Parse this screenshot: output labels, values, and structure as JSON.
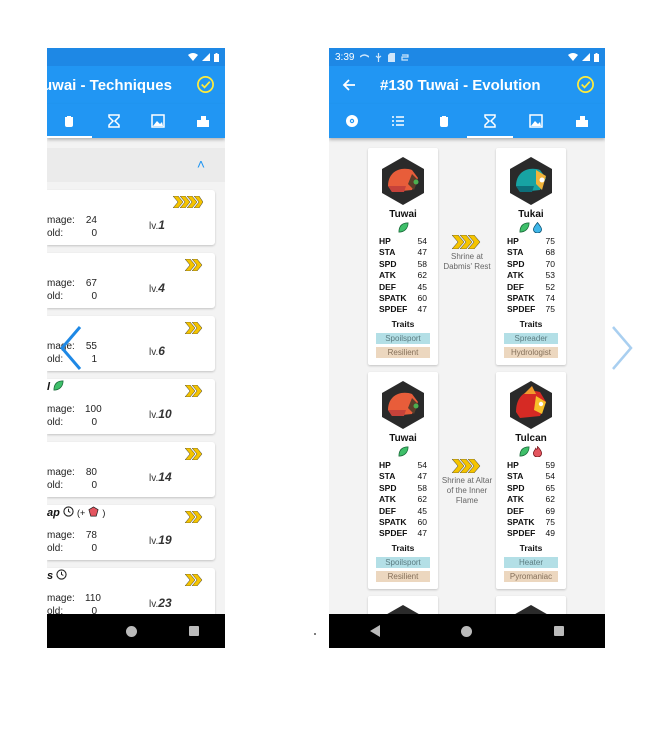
{
  "left_screen": {
    "title": "uwai - Techniques",
    "tabs": [
      "technique-tab",
      "evolution-tab",
      "gallery-tab",
      "habitat-tab"
    ],
    "techniques": [
      {
        "name": "",
        "damage_label": "mage:",
        "damage": "24",
        "hold_label": "old:",
        "hold": "0",
        "lv_prefix": "lv.",
        "level": "1",
        "chevrons": 4
      },
      {
        "name": "",
        "damage_label": "mage:",
        "damage": "67",
        "hold_label": "old:",
        "hold": "0",
        "lv_prefix": "lv.",
        "level": "4",
        "chevrons": 2
      },
      {
        "name": "",
        "damage_label": "mage:",
        "damage": "55",
        "hold_label": "old:",
        "hold": "1",
        "lv_prefix": "lv.",
        "level": "6",
        "chevrons": 2
      },
      {
        "name": "l",
        "damage_label": "mage:",
        "damage": "100",
        "hold_label": "old:",
        "hold": "0",
        "lv_prefix": "lv.",
        "level": "10",
        "chevrons": 2
      },
      {
        "name": "",
        "damage_label": "mage:",
        "damage": "80",
        "hold_label": "old:",
        "hold": "0",
        "lv_prefix": "lv.",
        "level": "14",
        "chevrons": 2
      },
      {
        "name": "ap",
        "extra": "(+",
        "extra_end": ")",
        "damage_label": "mage:",
        "damage": "78",
        "hold_label": "old:",
        "hold": "0",
        "lv_prefix": "lv.",
        "level": "19",
        "chevrons": 2
      },
      {
        "name": "s",
        "damage_label": "mage:",
        "damage": "110",
        "hold_label": "old:",
        "hold": "0",
        "lv_prefix": "lv.",
        "level": "23",
        "chevrons": 2
      }
    ]
  },
  "right_screen": {
    "time": "3:39",
    "title": "#130 Tuwai - Evolution",
    "tabs": [
      "info-tab",
      "list-tab",
      "technique-tab",
      "evolution-tab",
      "gallery-tab",
      "habitat-tab"
    ],
    "stat_keys": [
      "HP",
      "STA",
      "SPD",
      "ATK",
      "DEF",
      "SPATK",
      "SPDEF"
    ],
    "traits_label": "Traits",
    "evolutions": [
      {
        "from": {
          "name": "Tuwai",
          "stats": [
            "54",
            "47",
            "58",
            "62",
            "45",
            "60",
            "47"
          ],
          "traits": [
            "Spoilsport",
            "Resilient"
          ]
        },
        "condition": "Shrine at Dabmis' Rest",
        "to": {
          "name": "Tukai",
          "stats": [
            "75",
            "68",
            "70",
            "53",
            "52",
            "74",
            "75"
          ],
          "traits": [
            "Spreader",
            "Hydrologist"
          ]
        }
      },
      {
        "from": {
          "name": "Tuwai",
          "stats": [
            "54",
            "47",
            "58",
            "62",
            "45",
            "60",
            "47"
          ],
          "traits": [
            "Spoilsport",
            "Resilient"
          ]
        },
        "condition": "Shrine at Altar of the Inner Flame",
        "to": {
          "name": "Tulcan",
          "stats": [
            "59",
            "54",
            "65",
            "62",
            "69",
            "75",
            "49"
          ],
          "traits": [
            "Heater",
            "Pyromaniac"
          ]
        }
      }
    ]
  },
  "colors": {
    "appbar": "#2196f3",
    "statusbar": "#1e88e5",
    "check": "#ffeb3b",
    "chevron": "#f5c400",
    "arrow_left": "#1e88e5",
    "arrow_right": "#a9cff0"
  },
  "pager": {
    "active_page": 2,
    "page_count": 2
  }
}
